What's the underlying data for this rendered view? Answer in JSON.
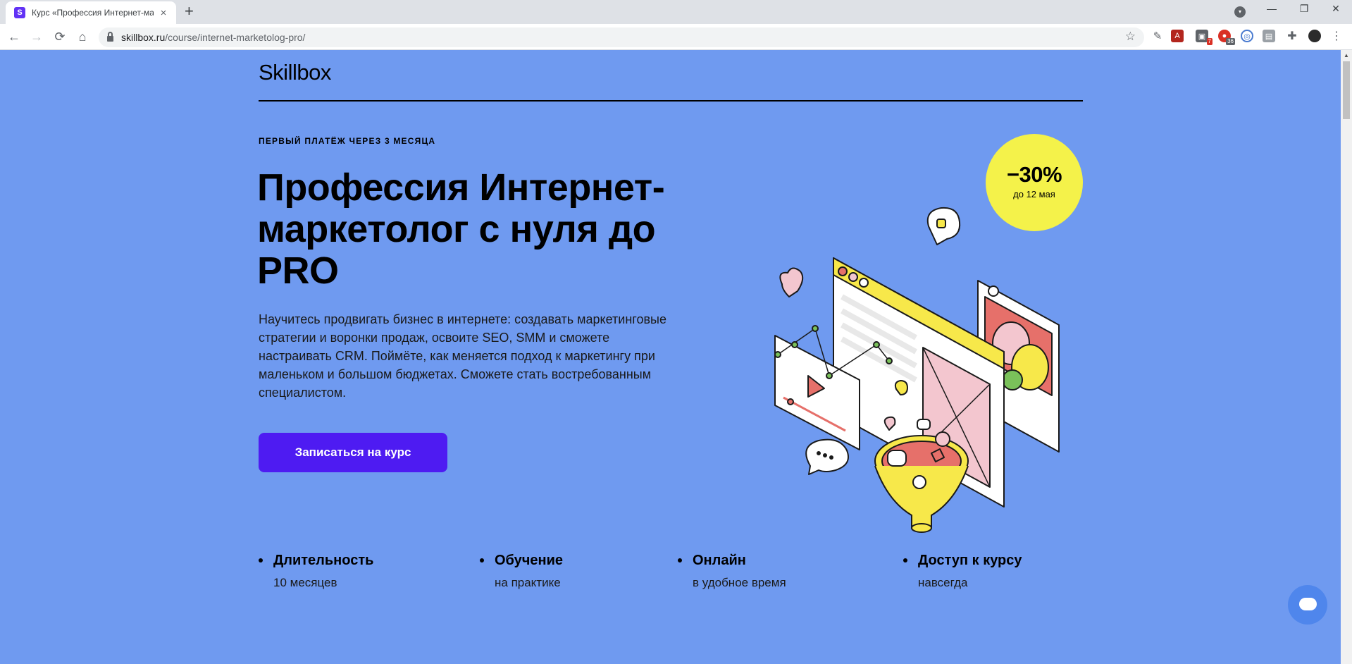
{
  "browser": {
    "tab_title": "Курс «Профессия Интернет-ма",
    "tab_favicon": "S",
    "tab_close": "×",
    "new_tab": "+",
    "url_host": "skillbox.ru",
    "url_path": "/course/internet-marketolog-pro/",
    "nav_back": "←",
    "nav_forward": "→",
    "nav_reload": "⟳",
    "nav_home": "⌂",
    "bookmark_star": "☆",
    "window_min": "—",
    "window_max": "❐",
    "window_close": "✕",
    "extension_badges": [
      "7",
      "36"
    ]
  },
  "page": {
    "logo": "Skillbox",
    "overline": "ПЕРВЫЙ ПЛАТЁЖ ЧЕРЕЗ 3 МЕСЯЦА",
    "headline": "Профессия Интернет-маркетолог с нуля до PRO",
    "description": "Научитесь продвигать бизнес в интернете: создавать маркетинговые стратегии и воронки продаж, освоите SEO, SMM и сможете настраивать CRM. Поймёте, как меняется подход к маркетингу при маленьком и большом бюджетах. Сможете стать востребованным специалистом.",
    "cta_label": "Записаться на курс",
    "discount": {
      "value": "−30%",
      "note": "до 12 мая"
    },
    "features": [
      {
        "title": "Длительность",
        "subtitle": "10 месяцев"
      },
      {
        "title": "Обучение",
        "subtitle": "на практике"
      },
      {
        "title": "Онлайн",
        "subtitle": "в удобное время"
      },
      {
        "title": "Доступ к курсу",
        "subtitle": "навсегда"
      }
    ]
  },
  "colors": {
    "page_background": "#6f9af0",
    "cta_background": "#4e1bf2",
    "discount_background": "#f4f24a",
    "illustration_yellow": "#f7e84a",
    "illustration_pink": "#f3c6cf",
    "illustration_red": "#e6706a",
    "illustration_green": "#7ac15a"
  }
}
